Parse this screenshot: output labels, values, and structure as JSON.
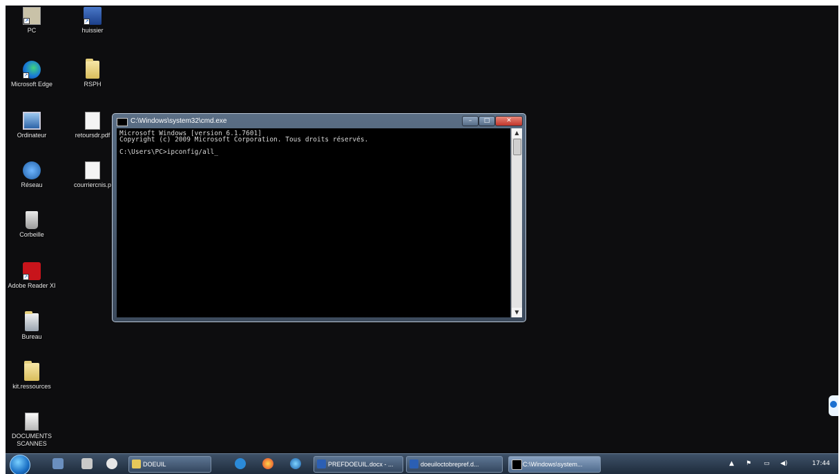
{
  "desktop": {
    "icons": [
      {
        "label": "PC",
        "icon": "computer-shortcut-icon"
      },
      {
        "label": "huissier",
        "icon": "shortcut-icon"
      },
      {
        "label": "Microsoft Edge",
        "icon": "edge-icon"
      },
      {
        "label": "RSPH",
        "icon": "folder-icon"
      },
      {
        "label": "Ordinateur",
        "icon": "computer-icon"
      },
      {
        "label": "retoursdr.pdf",
        "icon": "document-icon"
      },
      {
        "label": "Réseau",
        "icon": "network-icon"
      },
      {
        "label": "courriercnis.p",
        "icon": "document-icon"
      },
      {
        "label": "Corbeille",
        "icon": "recycle-bin-icon"
      },
      {
        "label": "Adobe Reader XI",
        "icon": "adobe-reader-icon"
      },
      {
        "label": "Bureau",
        "icon": "folder-icon"
      },
      {
        "label": "kit.ressources",
        "icon": "folder-icon"
      },
      {
        "label": "DOCUMENTS\nSCANNES",
        "icon": "scanned-docs-icon"
      }
    ]
  },
  "cmd": {
    "title": "C:\\Windows\\system32\\cmd.exe",
    "line1": "Microsoft Windows [version 6.1.7601]",
    "line2": "Copyright (c) 2009 Microsoft Corporation. Tous droits réservés.",
    "prompt": "C:\\Users\\PC>ipconfig/all_",
    "minimize": "–",
    "maximize": "□",
    "close": "✕"
  },
  "taskbar": {
    "buttons": [
      {
        "label": "DOEUIL",
        "icon": "folder-icon"
      },
      {
        "label": "PREFDOEUIL.docx - ...",
        "icon": "word-icon"
      },
      {
        "label": "doeuiloctobrepref.d...",
        "icon": "word-icon"
      },
      {
        "label": "C:\\Windows\\system...",
        "icon": "cmd-icon"
      }
    ],
    "clock": "17:44"
  },
  "colors": {
    "desktop": "#0d0d0f",
    "taskbar": "#2b3a4d",
    "cmd_bg": "#000000"
  }
}
